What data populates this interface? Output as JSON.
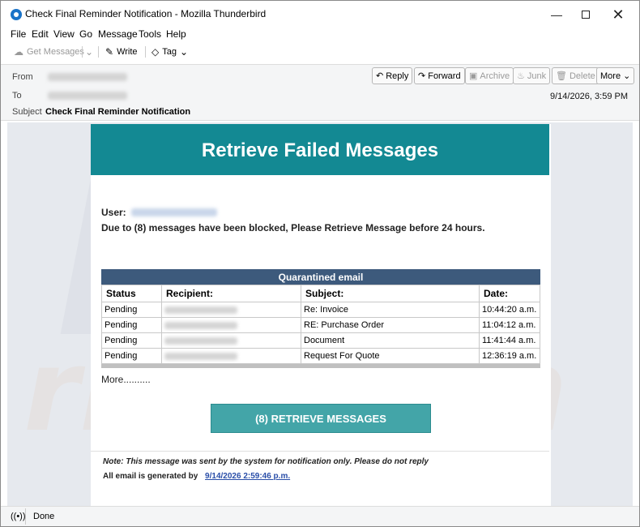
{
  "window": {
    "title": "Check Final Reminder Notification - Mozilla Thunderbird",
    "min_glyph": "—",
    "close_glyph": "✕"
  },
  "menu": [
    "File",
    "Edit",
    "View",
    "Go",
    "Message",
    "Tools",
    "Help"
  ],
  "toolbar": {
    "get_messages": "Get Messages",
    "write": "Write",
    "tag": "Tag"
  },
  "header": {
    "from_label": "From",
    "to_label": "To",
    "subject_label": "Subject",
    "subject": "Check Final Reminder Notification",
    "date": "9/14/2026, 3:59 PM",
    "buttons": {
      "reply": "Reply",
      "forward": "Forward",
      "archive": "Archive",
      "junk": "Junk",
      "delete": "Delete",
      "more": "More"
    }
  },
  "email": {
    "banner": "Retrieve Failed Messages",
    "user_label": "User:",
    "notice": "Due to (8) messages have been blocked, Please Retrieve Message before 24 hours.",
    "table_title": "Quarantined email",
    "columns": [
      "Status",
      "Recipient:",
      "Subject:",
      "Date:"
    ],
    "rows": [
      {
        "status": "Pending",
        "subject": "Re: Invoice",
        "date": "10:44:20 a.m."
      },
      {
        "status": "Pending",
        "subject": "RE: Purchase Order",
        "date": "11:04:12 a.m."
      },
      {
        "status": "Pending",
        "subject": "Document",
        "date": "11:41:44 a.m."
      },
      {
        "status": "Pending",
        "subject": "Request For Quote",
        "date": "12:36:19 a.m."
      }
    ],
    "more_text": "More..........",
    "button": "(8) RETRIEVE MESSAGES",
    "note": "Note: This message was sent by the system for notification only. Please do not reply",
    "generated_label": "All email is generated by",
    "generated_date": "9/14/2026 2:59:46 p.m."
  },
  "status": {
    "text": "Done"
  },
  "colors": {
    "banner": "#138993",
    "button": "#43a5a8",
    "table_header": "#3d5a7c",
    "link": "#2a4ea8"
  }
}
